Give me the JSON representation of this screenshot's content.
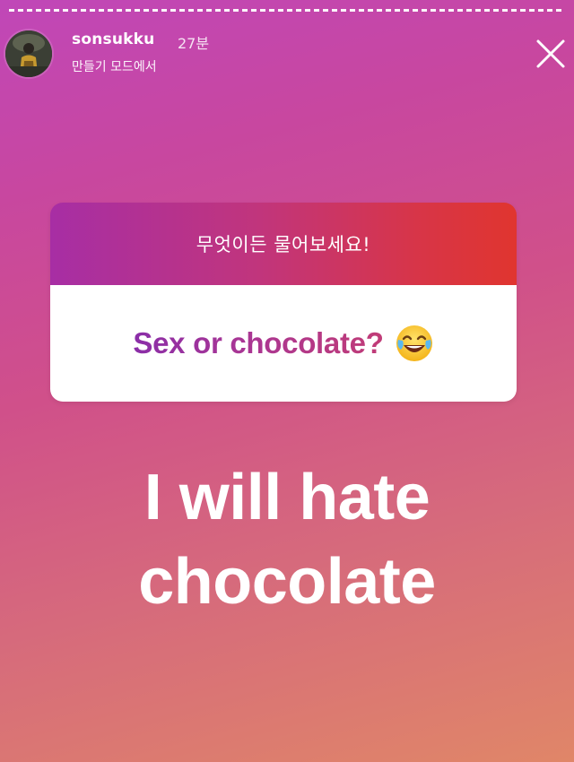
{
  "story": {
    "username": "sonsukku",
    "time_ago": "27분",
    "subtitle": "만들기 모드에서"
  },
  "question_sticker": {
    "prompt": "무엇이든 물어보세요!",
    "question": "Sex or chocolate?"
  },
  "answer": {
    "line1": "I will hate",
    "line2": "chocolate"
  },
  "icons": {
    "close": "close-icon",
    "emoji": "tears-of-joy-emoji-icon"
  },
  "colors": {
    "header_gradient_start": "#a72ea4",
    "header_gradient_end": "#e0352f",
    "question_text": "#a73596",
    "answer_text": "#ffffff"
  }
}
